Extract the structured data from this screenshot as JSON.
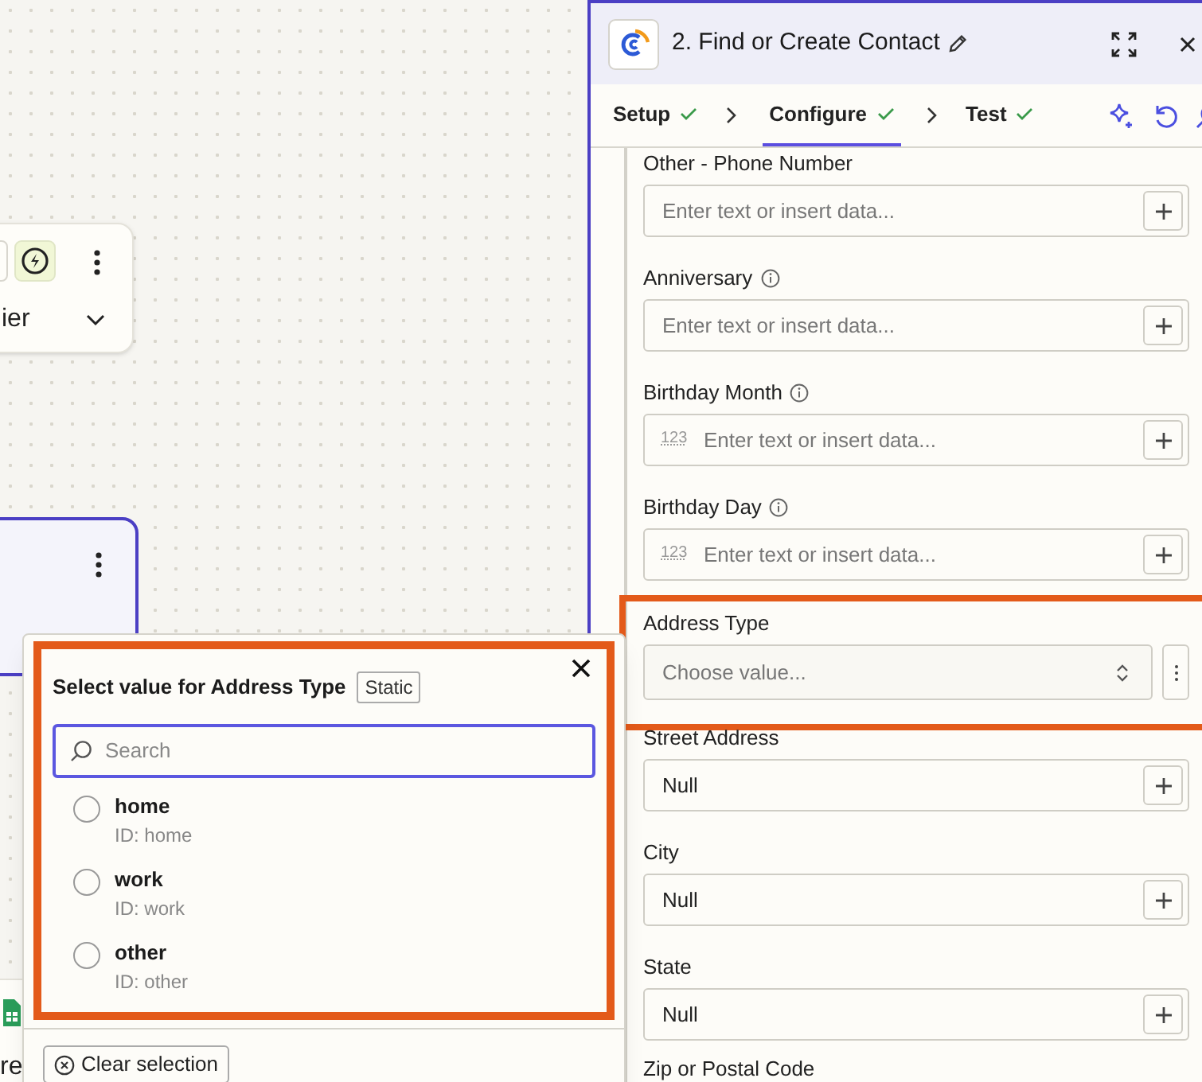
{
  "canvas": {
    "nodes": [
      {
        "kind": "trigger",
        "label": "ier",
        "selected": false
      },
      {
        "kind": "action",
        "selected": true
      },
      {
        "kind": "sheet",
        "label": "re",
        "selected": false
      }
    ]
  },
  "panel": {
    "title": "2. Find or Create Contact",
    "tabs": [
      {
        "label": "Setup",
        "done": true,
        "selected": false
      },
      {
        "label": "Configure",
        "done": true,
        "selected": true
      },
      {
        "label": "Test",
        "done": true,
        "selected": false
      }
    ],
    "fields": [
      {
        "kind": "text",
        "label": "Other - Phone Number",
        "info": false,
        "placeholder": "Enter text or insert data...",
        "highlighted": false
      },
      {
        "kind": "text",
        "label": "Anniversary",
        "info": true,
        "placeholder": "Enter text or insert data...",
        "highlighted": false
      },
      {
        "kind": "number",
        "label": "Birthday Month",
        "info": true,
        "prefix": "123",
        "placeholder": "Enter text or insert data...",
        "highlighted": false
      },
      {
        "kind": "number",
        "label": "Birthday Day",
        "info": true,
        "prefix": "123",
        "placeholder": "Enter text or insert data...",
        "highlighted": false
      },
      {
        "kind": "select",
        "label": "Address Type",
        "info": false,
        "placeholder": "Choose value...",
        "highlighted": true
      },
      {
        "kind": "text",
        "label": "Street Address",
        "info": false,
        "value": "Null",
        "highlighted": false
      },
      {
        "kind": "text",
        "label": "City",
        "info": false,
        "value": "Null",
        "highlighted": false
      },
      {
        "kind": "text",
        "label": "State",
        "info": false,
        "value": "Null",
        "highlighted": false
      },
      {
        "kind": "label",
        "label": "Zip or Postal Code",
        "info": false,
        "highlighted": false
      }
    ]
  },
  "popover": {
    "title": "Select value for Address Type",
    "badge": "Static",
    "highlighted": true,
    "search": {
      "placeholder": "Search"
    },
    "options": [
      {
        "label": "home",
        "id": "ID: home",
        "selected": false
      },
      {
        "label": "work",
        "id": "ID: work",
        "selected": false
      },
      {
        "label": "other",
        "id": "ID: other",
        "selected": false
      }
    ],
    "footer_button": "Clear selection"
  }
}
